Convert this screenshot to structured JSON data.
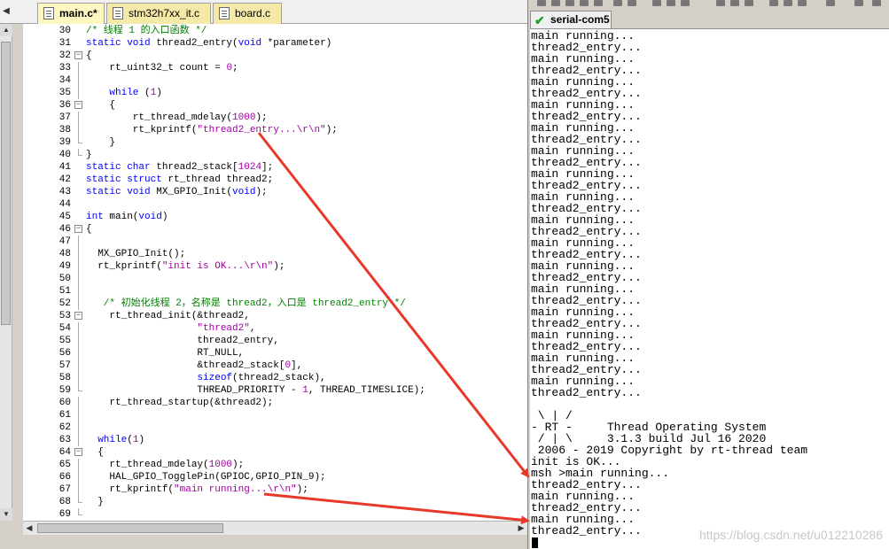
{
  "editor": {
    "tabs": [
      {
        "label": "main.c*",
        "active": true
      },
      {
        "label": "stm32h7xx_it.c",
        "active": false
      },
      {
        "label": "board.c",
        "active": false
      }
    ],
    "lines": [
      {
        "n": "30",
        "fold": "",
        "parts": [
          [
            "comment",
            "/* 线程 1 的入口函数 */"
          ]
        ]
      },
      {
        "n": "31",
        "fold": "",
        "parts": [
          [
            "keyword",
            "static void "
          ],
          [
            "normal",
            "thread2_entry("
          ],
          [
            "keyword",
            "void "
          ],
          [
            "normal",
            "*parameter)"
          ]
        ]
      },
      {
        "n": "32",
        "fold": "box",
        "parts": [
          [
            "normal",
            "{"
          ]
        ]
      },
      {
        "n": "33",
        "fold": "line",
        "parts": [
          [
            "normal",
            "    rt_uint32_t count = "
          ],
          [
            "number",
            "0"
          ],
          [
            "normal",
            ";"
          ]
        ]
      },
      {
        "n": "34",
        "fold": "line",
        "parts": []
      },
      {
        "n": "35",
        "fold": "line",
        "parts": [
          [
            "keyword",
            "    while "
          ],
          [
            "normal",
            "("
          ],
          [
            "number",
            "1"
          ],
          [
            "normal",
            ")"
          ]
        ]
      },
      {
        "n": "36",
        "fold": "box",
        "parts": [
          [
            "normal",
            "    {"
          ]
        ]
      },
      {
        "n": "37",
        "fold": "line",
        "parts": [
          [
            "normal",
            "        rt_thread_mdelay("
          ],
          [
            "number",
            "1000"
          ],
          [
            "normal",
            ");"
          ]
        ]
      },
      {
        "n": "38",
        "fold": "line",
        "parts": [
          [
            "normal",
            "        rt_kprintf("
          ],
          [
            "string",
            "\"thread2_entry...\\r\\n\""
          ],
          [
            "normal",
            ");"
          ]
        ]
      },
      {
        "n": "39",
        "fold": "end",
        "parts": [
          [
            "normal",
            "    }"
          ]
        ]
      },
      {
        "n": "40",
        "fold": "end",
        "parts": [
          [
            "normal",
            "}"
          ]
        ]
      },
      {
        "n": "41",
        "fold": "",
        "parts": [
          [
            "keyword",
            "static char "
          ],
          [
            "normal",
            "thread2_stack["
          ],
          [
            "number",
            "1024"
          ],
          [
            "normal",
            "];"
          ]
        ]
      },
      {
        "n": "42",
        "fold": "",
        "parts": [
          [
            "keyword",
            "static struct "
          ],
          [
            "normal",
            "rt_thread thread2;"
          ]
        ]
      },
      {
        "n": "43",
        "fold": "",
        "parts": [
          [
            "keyword",
            "static void "
          ],
          [
            "normal",
            "MX_GPIO_Init("
          ],
          [
            "keyword",
            "void"
          ],
          [
            "normal",
            ");"
          ]
        ]
      },
      {
        "n": "44",
        "fold": "",
        "parts": []
      },
      {
        "n": "45",
        "fold": "",
        "parts": [
          [
            "keyword",
            "int "
          ],
          [
            "normal",
            "main("
          ],
          [
            "keyword",
            "void"
          ],
          [
            "normal",
            ")"
          ]
        ]
      },
      {
        "n": "46",
        "fold": "box",
        "parts": [
          [
            "normal",
            "{"
          ]
        ]
      },
      {
        "n": "47",
        "fold": "line",
        "parts": []
      },
      {
        "n": "48",
        "fold": "line",
        "parts": [
          [
            "normal",
            "  MX_GPIO_Init();"
          ]
        ]
      },
      {
        "n": "49",
        "fold": "line",
        "parts": [
          [
            "normal",
            "  rt_kprintf("
          ],
          [
            "string",
            "\"init is OK...\\r\\n\""
          ],
          [
            "normal",
            ");"
          ]
        ]
      },
      {
        "n": "50",
        "fold": "line",
        "parts": []
      },
      {
        "n": "51",
        "fold": "line",
        "parts": []
      },
      {
        "n": "52",
        "fold": "line",
        "parts": [
          [
            "comment",
            "   /* 初始化线程 2，名称是 thread2，入口是 thread2_entry */"
          ]
        ]
      },
      {
        "n": "53",
        "fold": "box",
        "parts": [
          [
            "normal",
            "    rt_thread_init(&thread2,"
          ]
        ]
      },
      {
        "n": "54",
        "fold": "line",
        "parts": [
          [
            "string",
            "                   \"thread2\""
          ],
          [
            "normal",
            ","
          ]
        ]
      },
      {
        "n": "55",
        "fold": "line",
        "parts": [
          [
            "normal",
            "                   thread2_entry,"
          ]
        ]
      },
      {
        "n": "56",
        "fold": "line",
        "parts": [
          [
            "normal",
            "                   RT_NULL,"
          ]
        ]
      },
      {
        "n": "57",
        "fold": "line",
        "parts": [
          [
            "normal",
            "                   &thread2_stack["
          ],
          [
            "number",
            "0"
          ],
          [
            "normal",
            "],"
          ]
        ]
      },
      {
        "n": "58",
        "fold": "line",
        "parts": [
          [
            "keyword",
            "                   sizeof"
          ],
          [
            "normal",
            "(thread2_stack),"
          ]
        ]
      },
      {
        "n": "59",
        "fold": "end",
        "parts": [
          [
            "normal",
            "                   THREAD_PRIORITY - "
          ],
          [
            "number",
            "1"
          ],
          [
            "normal",
            ", THREAD_TIMESLICE);"
          ]
        ]
      },
      {
        "n": "60",
        "fold": "line",
        "parts": [
          [
            "normal",
            "    rt_thread_startup(&thread2);"
          ]
        ]
      },
      {
        "n": "61",
        "fold": "line",
        "parts": []
      },
      {
        "n": "62",
        "fold": "line",
        "parts": []
      },
      {
        "n": "63",
        "fold": "line",
        "parts": [
          [
            "keyword",
            "  while"
          ],
          [
            "normal",
            "("
          ],
          [
            "number",
            "1"
          ],
          [
            "normal",
            ")"
          ]
        ]
      },
      {
        "n": "64",
        "fold": "box",
        "parts": [
          [
            "normal",
            "  {"
          ]
        ]
      },
      {
        "n": "65",
        "fold": "line",
        "parts": [
          [
            "normal",
            "    rt_thread_mdelay("
          ],
          [
            "number",
            "1000"
          ],
          [
            "normal",
            ");"
          ]
        ]
      },
      {
        "n": "66",
        "fold": "line",
        "parts": [
          [
            "normal",
            "    HAL_GPIO_TogglePin(GPIOC,GPIO_PIN_9);"
          ]
        ]
      },
      {
        "n": "67",
        "fold": "line",
        "parts": [
          [
            "normal",
            "    rt_kprintf("
          ],
          [
            "string",
            "\"main running...\\r\\n\""
          ],
          [
            "normal",
            ");"
          ]
        ]
      },
      {
        "n": "68",
        "fold": "end",
        "parts": [
          [
            "normal",
            "  }"
          ]
        ]
      },
      {
        "n": "69",
        "fold": "end",
        "parts": []
      }
    ]
  },
  "terminal": {
    "tab_label": "serial-com5",
    "lines": [
      "main running...",
      "thread2_entry...",
      "main running...",
      "thread2_entry...",
      "main running...",
      "thread2_entry...",
      "main running...",
      "thread2_entry...",
      "main running...",
      "thread2_entry...",
      "main running...",
      "thread2_entry...",
      "main running...",
      "thread2_entry...",
      "main running...",
      "thread2_entry...",
      "main running...",
      "thread2_entry...",
      "main running...",
      "thread2_entry...",
      "main running...",
      "thread2_entry...",
      "main running...",
      "thread2_entry...",
      "main running...",
      "thread2_entry...",
      "main running...",
      "thread2_entry...",
      "main running...",
      "thread2_entry...",
      "main running...",
      "thread2_entry...",
      "",
      " \\ | /",
      "- RT -     Thread Operating System",
      " / | \\     3.1.3 build Jul 16 2020",
      " 2006 - 2019 Copyright by rt-thread team",
      "init is OK...",
      "msh >main running...",
      "thread2_entry...",
      "main running...",
      "thread2_entry...",
      "main running...",
      "thread2_entry..."
    ],
    "watermark": "https://blog.csdn.net/u012210286"
  },
  "colors": {
    "annotation_arrow": "#e8382a",
    "keyword": "#0000ff",
    "comment": "#008000",
    "string": "#a000a0"
  }
}
